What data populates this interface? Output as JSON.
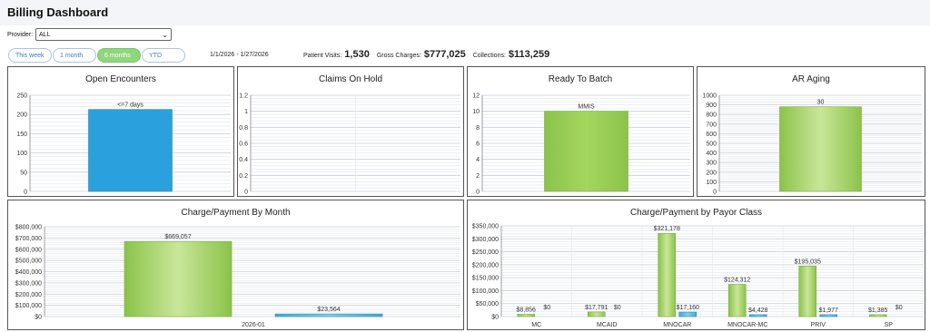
{
  "header": {
    "title": "Billing Dashboard"
  },
  "provider": {
    "label": "Provider:",
    "value": "ALL"
  },
  "range_buttons": [
    {
      "label": "This week",
      "active": false
    },
    {
      "label": "1 month",
      "active": false
    },
    {
      "label": "6 months",
      "active": true
    },
    {
      "label": "YTD",
      "active": false
    }
  ],
  "date_range": {
    "start": "1/1/2026",
    "end": "- 1/27/2026"
  },
  "stats": [
    {
      "label": "Patient Visits:",
      "value": "1,530"
    },
    {
      "label": "Gross Charges:",
      "value": "$777,025"
    },
    {
      "label": "Collections:",
      "value": "$113,259"
    }
  ],
  "colors": {
    "blue": "#2aa1dc",
    "green": "#8bc34a",
    "teal": "#3aaed8"
  },
  "chart_data": [
    {
      "type": "bar",
      "title": "Open Encounters",
      "categories": [
        "<=7 days"
      ],
      "values": [
        213
      ],
      "ylim": [
        0,
        250
      ],
      "yticks": [
        "0",
        "50",
        "100",
        "150",
        "200",
        "250"
      ],
      "tick_values": [
        0,
        50,
        100,
        150,
        200,
        250
      ],
      "data_labels": [
        "<=7 days"
      ],
      "color": "#2aa1dc",
      "grid": true
    },
    {
      "type": "bar",
      "title": "Claims On Hold",
      "categories": [],
      "values": [],
      "ylim": [
        0,
        1.2
      ],
      "yticks": [
        "0",
        "0.2",
        "0.4",
        "0.6",
        "0.8",
        "1",
        "1.2"
      ],
      "tick_values": [
        0,
        0.2,
        0.4,
        0.6,
        0.8,
        1,
        1.2
      ],
      "data_labels": [],
      "color": "#8bc34a",
      "grid": true
    },
    {
      "type": "bar",
      "title": "Ready To Batch",
      "categories": [
        "MMIS"
      ],
      "values": [
        10
      ],
      "ylim": [
        0,
        12
      ],
      "yticks": [
        "0",
        "2",
        "4",
        "6",
        "8",
        "10",
        "12"
      ],
      "tick_values": [
        0,
        2,
        4,
        6,
        8,
        10,
        12
      ],
      "data_labels": [
        "MMIS"
      ],
      "color": "#8bc34a",
      "grid": true
    },
    {
      "type": "bar",
      "title": "AR Aging",
      "categories": [
        "30"
      ],
      "values": [
        880
      ],
      "ylim": [
        0,
        1000
      ],
      "yticks": [
        "0",
        "100",
        "200",
        "300",
        "400",
        "500",
        "600",
        "700",
        "800",
        "900",
        "1000"
      ],
      "tick_values": [
        0,
        100,
        200,
        300,
        400,
        500,
        600,
        700,
        800,
        900,
        1000
      ],
      "data_labels": [
        "30"
      ],
      "color": "#8bc34a",
      "grid": true
    },
    {
      "type": "bar",
      "title": "Charge/Payment By Month",
      "categories": [
        "2026-01"
      ],
      "series": [
        {
          "values": [
            669057
          ],
          "labels": [
            "$669,057"
          ]
        },
        {
          "values": [
            23564
          ],
          "labels": [
            "$23,564"
          ]
        }
      ],
      "ylim": [
        0,
        800000
      ],
      "yticks": [
        "$0",
        "$100,000",
        "$200,000",
        "$300,000",
        "$400,000",
        "$500,000",
        "$600,000",
        "$700,000",
        "$800,000"
      ],
      "tick_values": [
        0,
        100000,
        200000,
        300000,
        400000,
        500000,
        600000,
        700000,
        800000
      ],
      "grid": true
    },
    {
      "type": "bar",
      "title": "Charge/Payment by Payor Class",
      "categories": [
        "MC",
        "MCAID",
        "MNOCAR",
        "MNOCAR-MC",
        "PRIV",
        "SP"
      ],
      "series": [
        {
          "values": [
            8856,
            17791,
            321178,
            124312,
            195035,
            1385
          ],
          "labels": [
            "$8,856",
            "$17,791",
            "$321,178",
            "$124,312",
            "$195,035",
            "$1,385"
          ]
        },
        {
          "values": [
            0,
            0,
            17160,
            4428,
            1977,
            0
          ],
          "labels": [
            "$0",
            "$0",
            "$17,160",
            "$4,428",
            "$1,977",
            "$0"
          ]
        }
      ],
      "ylim": [
        0,
        350000
      ],
      "yticks": [
        "$0",
        "$50,000",
        "$100,000",
        "$150,000",
        "$200,000",
        "$250,000",
        "$300,000",
        "$350,000"
      ],
      "tick_values": [
        0,
        50000,
        100000,
        150000,
        200000,
        250000,
        300000,
        350000
      ],
      "grid": true
    }
  ]
}
